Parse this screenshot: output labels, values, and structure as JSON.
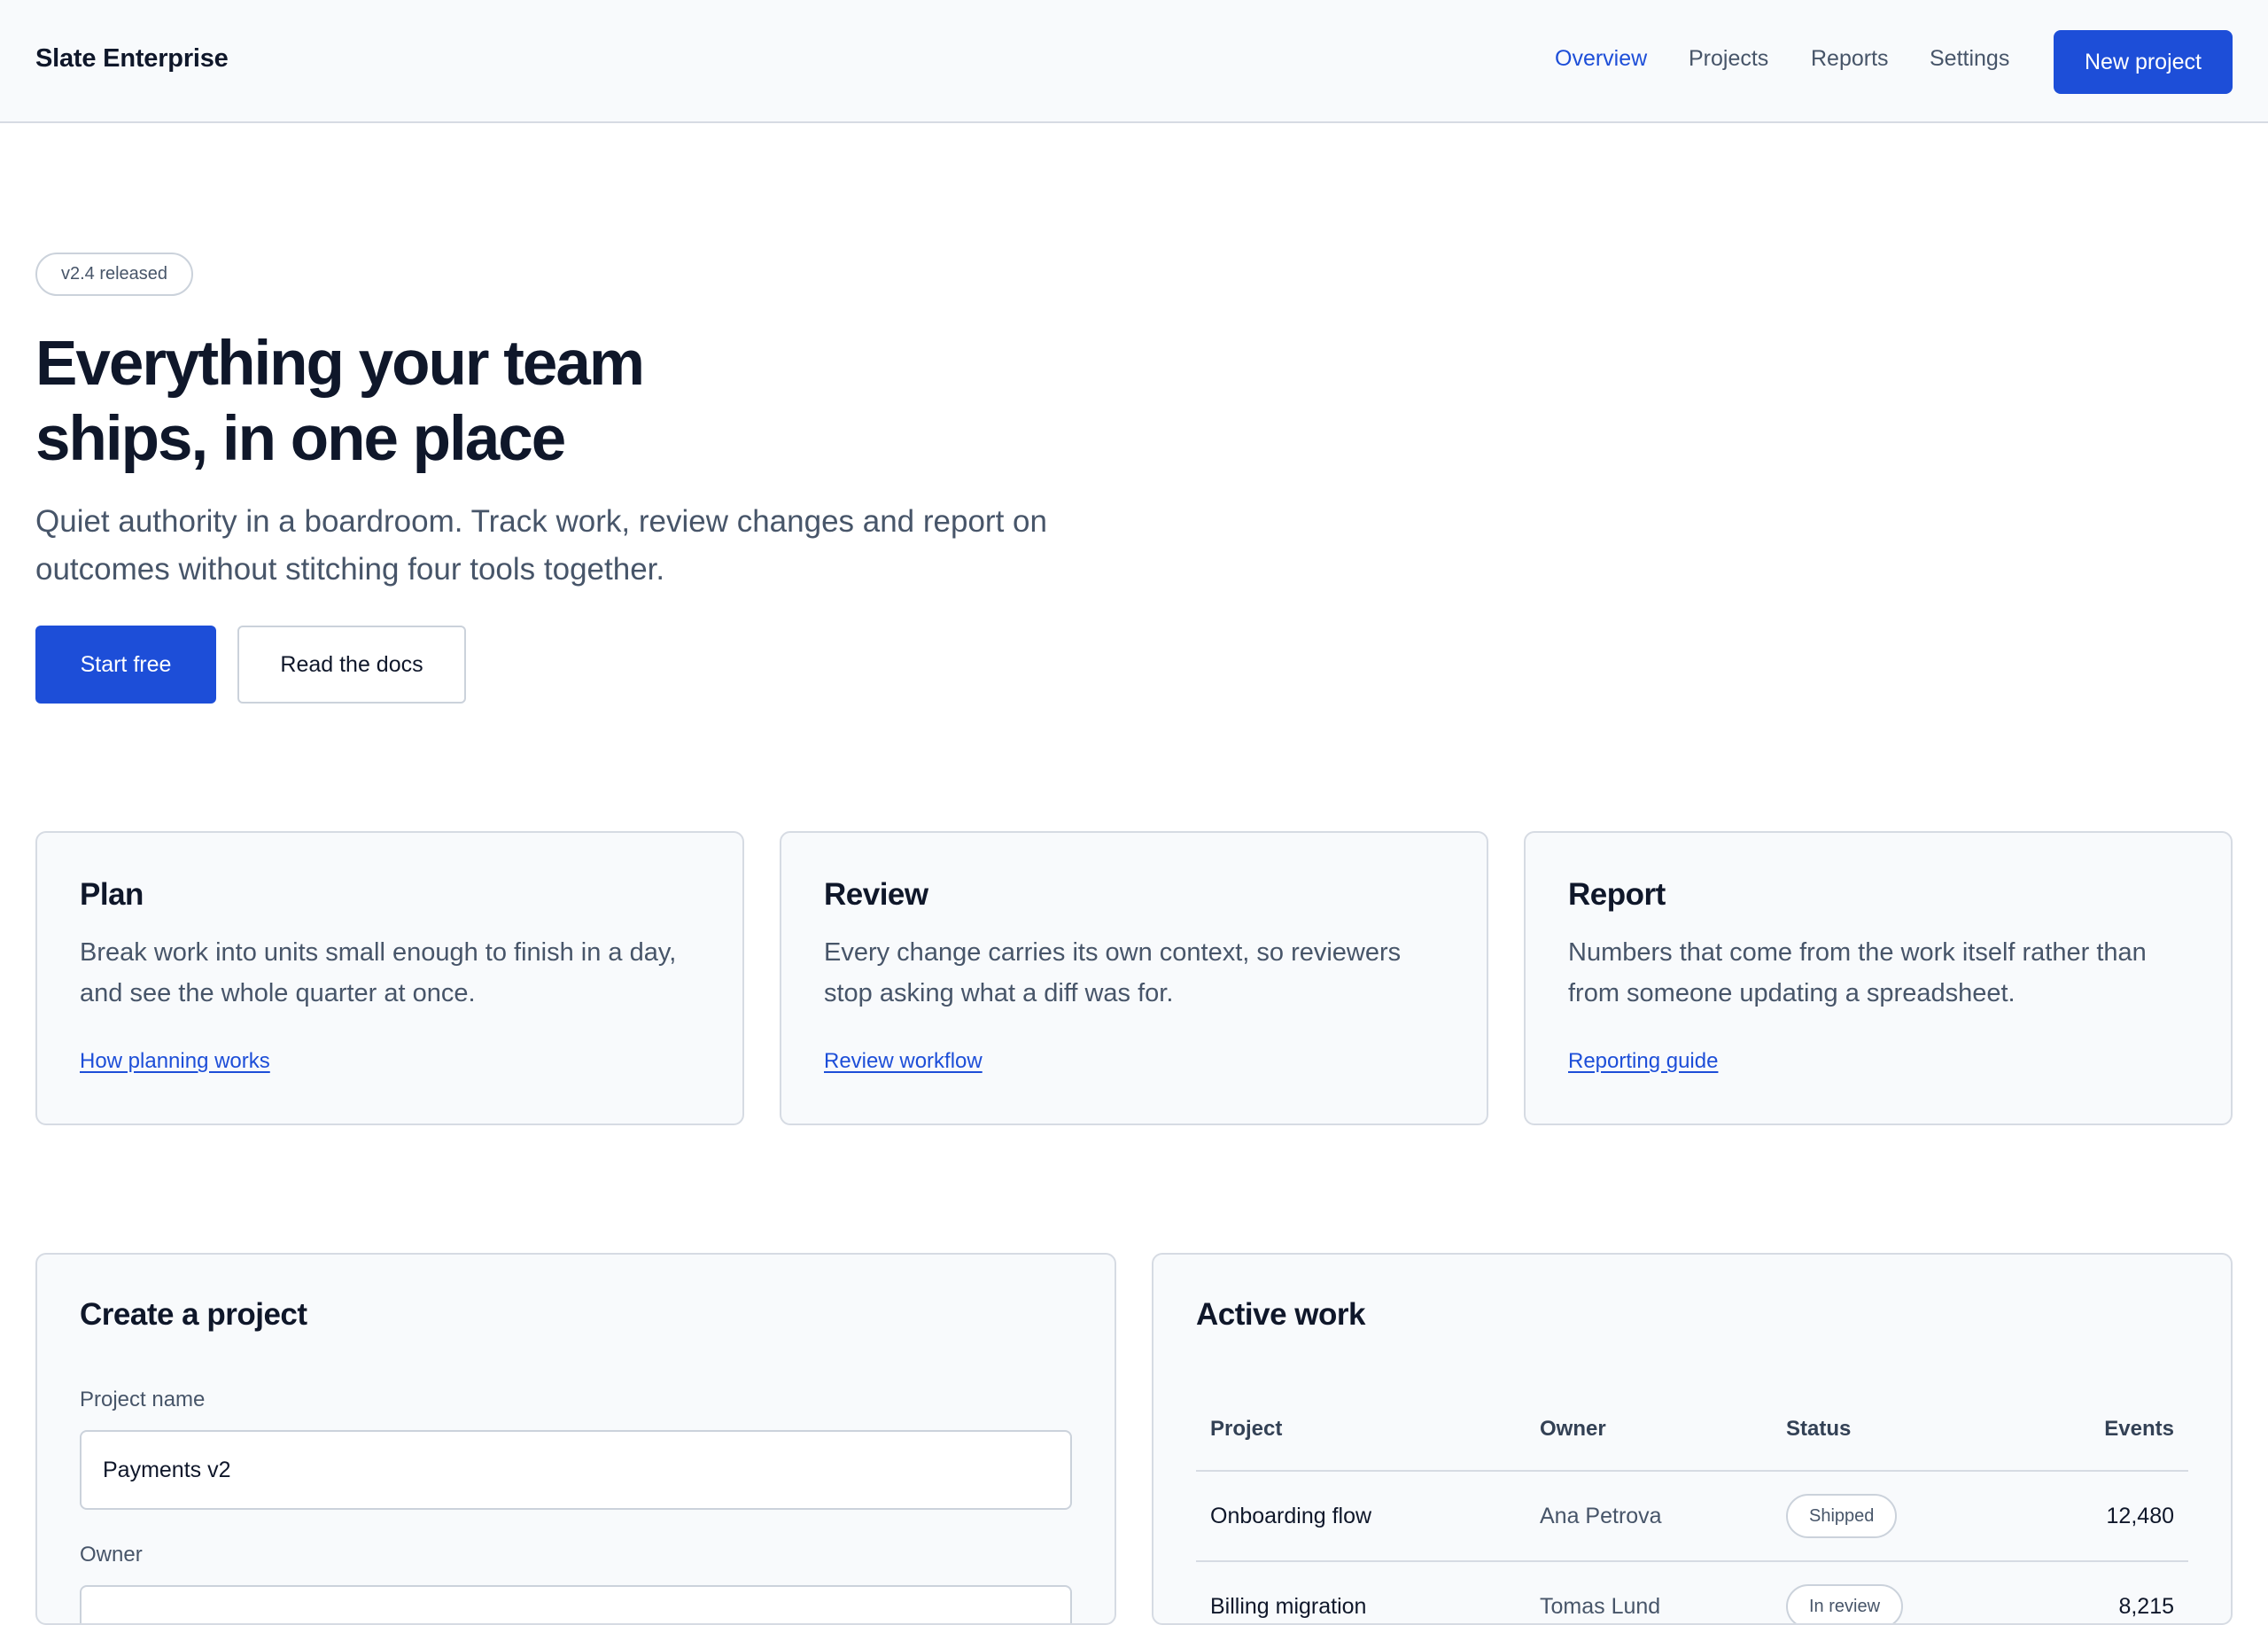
{
  "header": {
    "brand": "Slate Enterprise",
    "nav": [
      {
        "label": "Overview",
        "active": true
      },
      {
        "label": "Projects",
        "active": false
      },
      {
        "label": "Reports",
        "active": false
      },
      {
        "label": "Settings",
        "active": false
      }
    ],
    "new_project_label": "New project"
  },
  "hero": {
    "badge": "v2.4 released",
    "title_line1": "Everything your team",
    "title_line2": "ships, in one place",
    "subtitle_line1": "Quiet authority in a boardroom. Track work, review changes and report on",
    "subtitle_line2": "outcomes without stitching four tools together.",
    "primary_cta": "Start free",
    "secondary_cta": "Read the docs"
  },
  "features": [
    {
      "title": "Plan",
      "body_line1": "Break work into units small enough to finish in a day,",
      "body_line2": "and see the whole quarter at once.",
      "link": "How planning works"
    },
    {
      "title": "Review",
      "body_line1": "Every change carries its own context, so reviewers",
      "body_line2": "stop asking what a diff was for.",
      "link": "Review workflow"
    },
    {
      "title": "Report",
      "body_line1": "Numbers that come from the work itself rather than",
      "body_line2": "from someone updating a spreadsheet.",
      "link": "Reporting guide"
    }
  ],
  "create_project": {
    "title": "Create a project",
    "name_label": "Project name",
    "name_value": "Payments v2",
    "owner_label": "Owner"
  },
  "active_work": {
    "title": "Active work",
    "columns": [
      "Project",
      "Owner",
      "Status",
      "Events"
    ],
    "rows": [
      {
        "project": "Onboarding flow",
        "owner": "Ana Petrova",
        "status": "Shipped",
        "events": "12,480"
      },
      {
        "project": "Billing migration",
        "owner": "Tomas Lund",
        "status": "In review",
        "events": "8,215"
      }
    ]
  },
  "colors": {
    "accent": "#1d4ed8",
    "text": "#0f172a",
    "muted": "#475569",
    "border": "#d6dbe3",
    "surface": "#f8fafc"
  }
}
